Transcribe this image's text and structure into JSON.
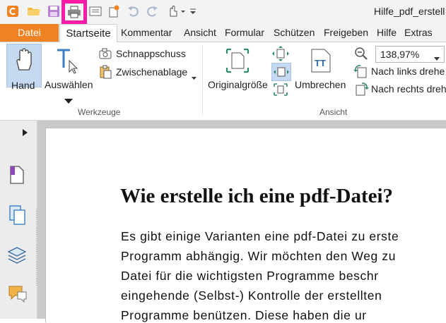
{
  "window": {
    "title": "Hilfe_pdf_erstell"
  },
  "menu": {
    "tabs": [
      "Datei",
      "Startseite",
      "Kommentar",
      "Ansicht",
      "Formular",
      "Schützen",
      "Freigeben",
      "Hilfe",
      "Extras"
    ]
  },
  "ribbon": {
    "werkzeuge": {
      "hand": "Hand",
      "auswaehlen": "Auswählen",
      "schnappschuss": "Schnappschuss",
      "zwischenablage": "Zwischenablage",
      "group": "Werkzeuge"
    },
    "ansicht": {
      "originalgroesse": "Originalgröße",
      "umbrechen": "Umbrechen",
      "zoom_value": "138,97%",
      "rotate_left": "Nach links drehe",
      "rotate_right": "Nach rechts dreh",
      "group": "Ansicht"
    }
  },
  "document": {
    "heading": "Wie erstelle ich eine pdf-Datei?",
    "lines": [
      "Es gibt einige Varianten eine pdf-Datei zu erste",
      "Programm abhängig. Wir möchten den Weg zu",
      "Datei für die wichtigsten Programme beschr",
      "eingehende (Selbst-) Kontrolle der erstellten",
      "Programme benützen. Diese haben die ur"
    ]
  },
  "colors": {
    "accent": "#ef8222",
    "highlight": "#ff1aa8",
    "selected": "#c5d9f1"
  },
  "icons": [
    "app-logo-icon",
    "open-folder-icon",
    "save-icon",
    "print-icon",
    "scan-icon",
    "new-icon",
    "undo-icon",
    "redo-icon",
    "hand-tool-icon",
    "customize-icon"
  ]
}
